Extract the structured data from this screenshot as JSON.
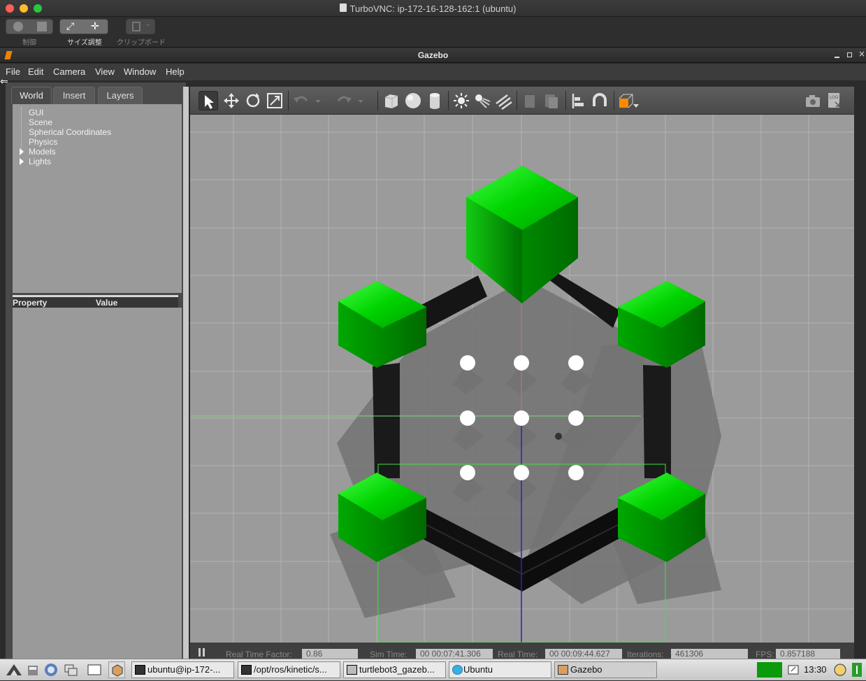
{
  "window": {
    "title": "TurboVNC: ip-172-16-128-162:1 (ubuntu)"
  },
  "vnc_toolbar": {
    "control_label": "制御",
    "resize_label": "サイズ調整",
    "clipboard_label": "クリップボード"
  },
  "app": {
    "title": "Gazebo"
  },
  "menubar": {
    "file": "File",
    "edit": "Edit",
    "camera": "Camera",
    "view": "View",
    "window": "Window",
    "help": "Help"
  },
  "left_panel": {
    "tabs": {
      "world": "World",
      "insert": "Insert",
      "layers": "Layers"
    },
    "tree": {
      "gui": "GUI",
      "scene": "Scene",
      "spherical": "Spherical Coordinates",
      "physics": "Physics",
      "models": "Models",
      "lights": "Lights"
    },
    "properties": {
      "property": "Property",
      "value": "Value"
    }
  },
  "toolbar_icons": [
    "select-arrow-icon",
    "translate-icon",
    "rotate-icon",
    "scale-icon",
    "undo-icon",
    "redo-icon",
    "box-icon",
    "sphere-icon",
    "cylinder-icon",
    "point-light-icon",
    "spot-light-icon",
    "directional-light-icon",
    "copy-icon",
    "paste-icon",
    "align-icon",
    "snap-icon",
    "view-angle-icon",
    "screenshot-icon",
    "log-icon"
  ],
  "status": {
    "rtf_label": "Real Time Factor:",
    "rtf": "0.86",
    "sim_label": "Sim Time:",
    "sim_time": "00 00:07:41.306",
    "real_label": "Real Time:",
    "real_time": "00 00:09:44.627",
    "iter_label": "Iterations:",
    "iterations": "461306",
    "fps_label": "FPS:",
    "fps": "0.857188"
  },
  "taskbar": {
    "items": {
      "t1": "ubuntu@ip-172-...",
      "t2": "/opt/ros/kinetic/s...",
      "t3": "turtlebot3_gazeb...",
      "t4": "Ubuntu",
      "t5": "Gazebo"
    },
    "clock": "13:30"
  },
  "colors": {
    "ground": "#9b9b9b",
    "wall": "#151515",
    "green": "#00c400",
    "accent": "#ff8a00"
  }
}
